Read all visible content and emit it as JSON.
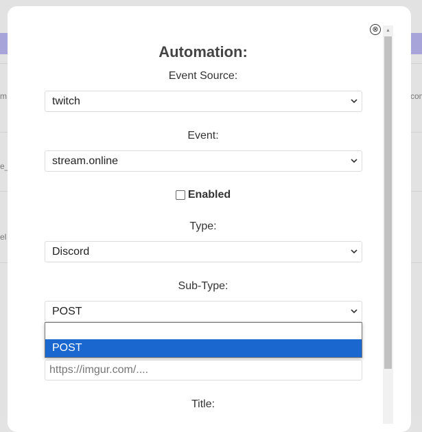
{
  "background": {
    "snippets": [
      "m.c",
      "e_",
      "el",
      "com"
    ]
  },
  "modal": {
    "close_icon": "⊗",
    "heading": "Automation:",
    "event_source": {
      "label": "Event Source:",
      "value": "twitch"
    },
    "event": {
      "label": "Event:",
      "value": "stream.online"
    },
    "enabled": {
      "label": "Enabled",
      "checked": false
    },
    "type": {
      "label": "Type:",
      "value": "Discord"
    },
    "subtype": {
      "label": "Sub-Type:",
      "value": "POST",
      "options": [
        "",
        "POST"
      ],
      "highlighted": "POST"
    },
    "url_input": {
      "placeholder": "https://imgur.com/...."
    },
    "title": {
      "label": "Title:"
    }
  },
  "colors": {
    "accent_bar": "#a7a4da",
    "selection": "#1a67cf"
  }
}
